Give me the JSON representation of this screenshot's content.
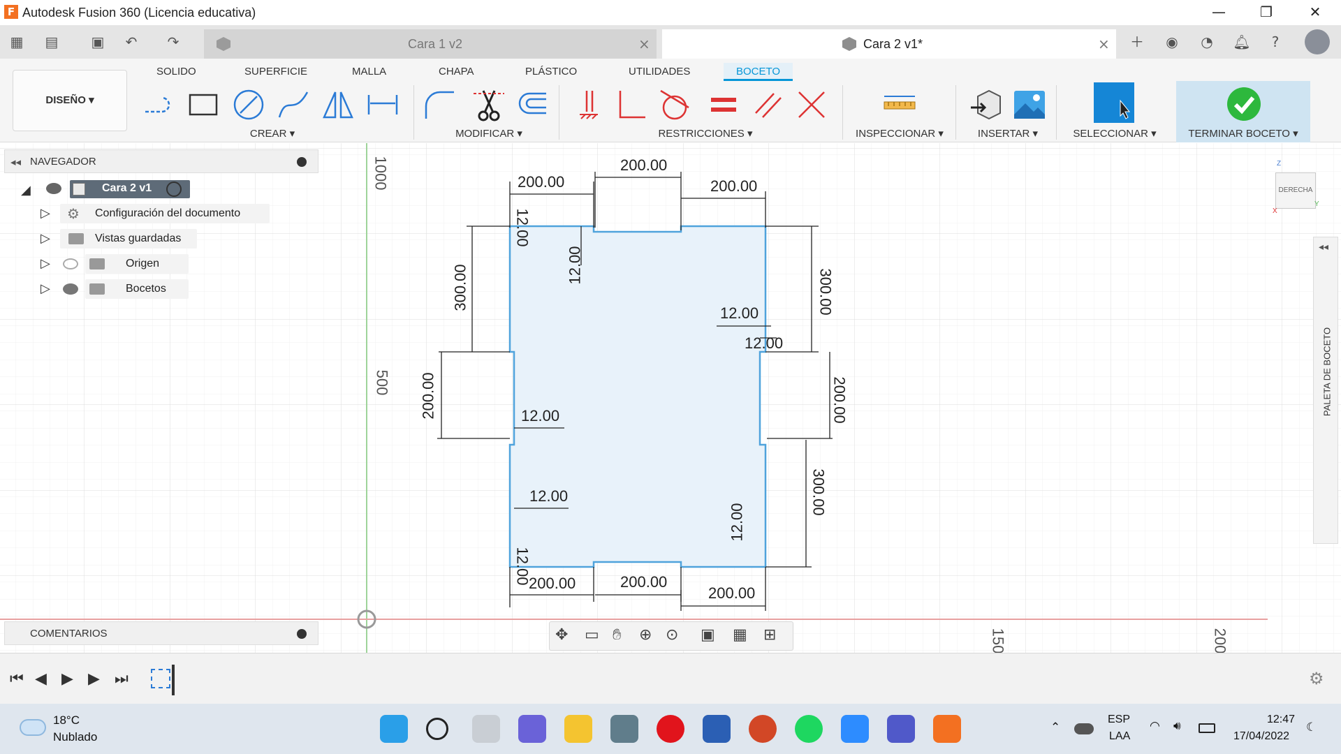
{
  "window": {
    "title": "Autodesk Fusion 360 (Licencia educativa)",
    "logo_letter": "F",
    "minimize": "—",
    "maximize": "❐",
    "close": "✕"
  },
  "doc_tabs": [
    {
      "label": "Cara 1 v2",
      "active": false
    },
    {
      "label": "Cara 2 v1*",
      "active": true
    }
  ],
  "ribbon": {
    "tabs": [
      "SOLIDO",
      "SUPERFICIE",
      "MALLA",
      "CHAPA",
      "PLÁSTICO",
      "UTILIDADES",
      "BOCETO"
    ],
    "active_tab": "BOCETO",
    "workspace": "DISEÑO ▾",
    "groups": {
      "crear": "CREAR ▾",
      "modificar": "MODIFICAR ▾",
      "restricciones": "RESTRICCIONES ▾",
      "inspeccionar": "INSPECCIONAR ▾",
      "insertar": "INSERTAR ▾",
      "seleccionar": "SELECCIONAR ▾",
      "terminar": "TERMINAR BOCETO ▾"
    }
  },
  "navigator": {
    "title": "NAVEGADOR",
    "root": "Cara 2 v1",
    "items": [
      {
        "label": "Configuración del documento",
        "icon": "gear-icon"
      },
      {
        "label": "Vistas guardadas",
        "icon": "folder-icon"
      },
      {
        "label": "Origen",
        "icon": "folder-icon",
        "hidden": true
      },
      {
        "label": "Bocetos",
        "icon": "folder-icon"
      }
    ]
  },
  "comments": {
    "title": "COMENTARIOS"
  },
  "viewcube": {
    "face": "DERECHA",
    "axis_z": "Z",
    "axis_y": "Y",
    "axis_x": "X"
  },
  "side_palette": {
    "label": "PALETA DE BOCETO"
  },
  "rulers": {
    "v_top": "1000",
    "v_mid": "500",
    "h_150": "150",
    "h_200": "200"
  },
  "dimensions": {
    "top_left": "200.00",
    "top_center": "200.00",
    "top_right": "200.00",
    "bottom_left": "200.00",
    "bottom_center": "200.00",
    "bottom_right": "200.00",
    "left_upper": "300.00",
    "left_middle": "200.00",
    "right_upper": "300.00",
    "right_middle": "200.00",
    "right_lower": "300.00",
    "t_top_left": "12.00",
    "t_top_notch": "12.00",
    "t_left_mid_1": "12.00",
    "t_left_mid_2": "12.00",
    "t_right_1": "12.00",
    "t_right_2": "12.00",
    "t_right_lower": "12.00",
    "t_bottom_left": "12.00"
  },
  "taskbar": {
    "weather_temp": "18°C",
    "weather_desc": "Nublado",
    "lang_1": "ESP",
    "lang_2": "LAA",
    "time": "12:47",
    "date": "17/04/2022"
  },
  "colors": {
    "accent": "#0696d7",
    "sketch_line": "#4fa3dc",
    "sketch_fill": "#e8f2fa",
    "finish_green": "#2db83d"
  }
}
